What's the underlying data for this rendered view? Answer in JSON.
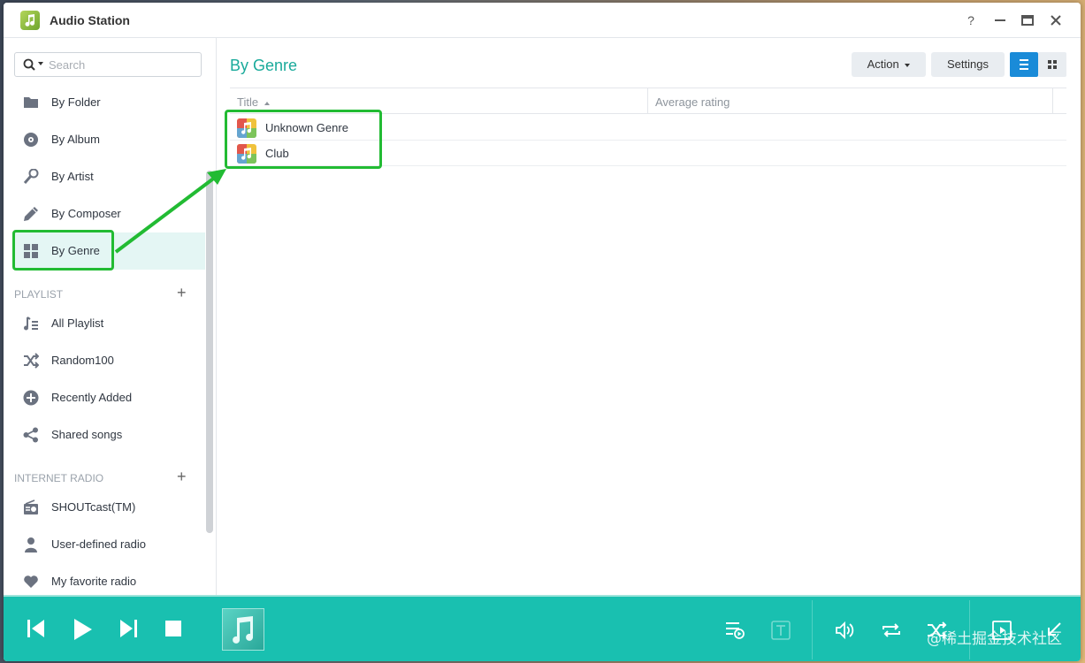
{
  "window": {
    "title": "Audio Station",
    "help": "?",
    "minimize": "–",
    "maximize": "□",
    "close": "✕"
  },
  "sidebar": {
    "search_placeholder": "Search",
    "library": [
      {
        "label": "By Folder",
        "icon": "folder-icon"
      },
      {
        "label": "By Album",
        "icon": "disc-icon"
      },
      {
        "label": "By Artist",
        "icon": "microphone-icon"
      },
      {
        "label": "By Composer",
        "icon": "pen-icon"
      },
      {
        "label": "By Genre",
        "icon": "grid-icon",
        "active": true
      }
    ],
    "playlist_header": "PLAYLIST",
    "playlist": [
      {
        "label": "All Playlist",
        "icon": "playlist-icon"
      },
      {
        "label": "Random100",
        "icon": "shuffle-icon"
      },
      {
        "label": "Recently Added",
        "icon": "plus-circle-icon"
      },
      {
        "label": "Shared songs",
        "icon": "share-icon"
      }
    ],
    "radio_header": "INTERNET RADIO",
    "radio": [
      {
        "label": "SHOUTcast(TM)",
        "icon": "radio-icon"
      },
      {
        "label": "User-defined radio",
        "icon": "user-icon"
      },
      {
        "label": "My favorite radio",
        "icon": "heart-icon"
      }
    ]
  },
  "main": {
    "title": "By Genre",
    "action_label": "Action",
    "settings_label": "Settings",
    "columns": {
      "title": "Title",
      "rating": "Average rating"
    },
    "rows": [
      {
        "title": "Unknown Genre",
        "rating": ""
      },
      {
        "title": "Club",
        "rating": ""
      }
    ]
  },
  "player": {
    "watermark": "@稀土掘金技术社区"
  },
  "colors": {
    "accent": "#1aaa9b",
    "player_bg": "#19c0b0",
    "highlight": "#22bb33",
    "active_view": "#1a8bd8"
  }
}
